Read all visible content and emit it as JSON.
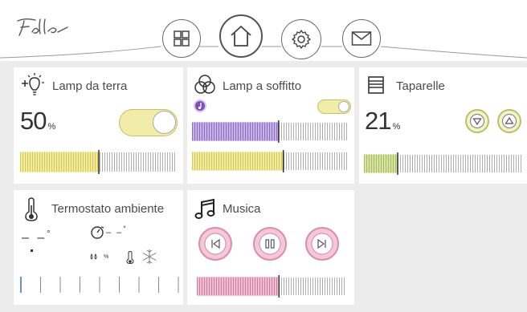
{
  "brand": {
    "logo_text": "Feller"
  },
  "nav": {
    "items": [
      {
        "icon": "grid-icon"
      },
      {
        "icon": "home-icon",
        "active": true
      },
      {
        "icon": "gear-icon"
      },
      {
        "icon": "mail-icon"
      }
    ]
  },
  "tiles": {
    "lamp_floor": {
      "title": "Lamp da terra",
      "value": "50",
      "unit": "%",
      "on": true,
      "level": 0.5,
      "accent": "#e8e07a"
    },
    "lamp_ceiling": {
      "title": "Lamp a soffitto",
      "on": true,
      "color_level": 0.55,
      "level": 0.58,
      "color_accent": "#8f6cc6",
      "accent": "#e8e07a"
    },
    "shutters": {
      "title": "Taparelle",
      "value": "21",
      "unit": "%",
      "level": 0.21,
      "accent": "#b7cc6a"
    },
    "thermostat": {
      "title": "Termostato ambiente",
      "current_temp": "– –",
      "temp_unit": "°",
      "setpoint": "– –",
      "humidity_label": "%"
    },
    "music": {
      "title": "Musica",
      "volume": 0.55,
      "accent": "#d98fb0"
    }
  }
}
